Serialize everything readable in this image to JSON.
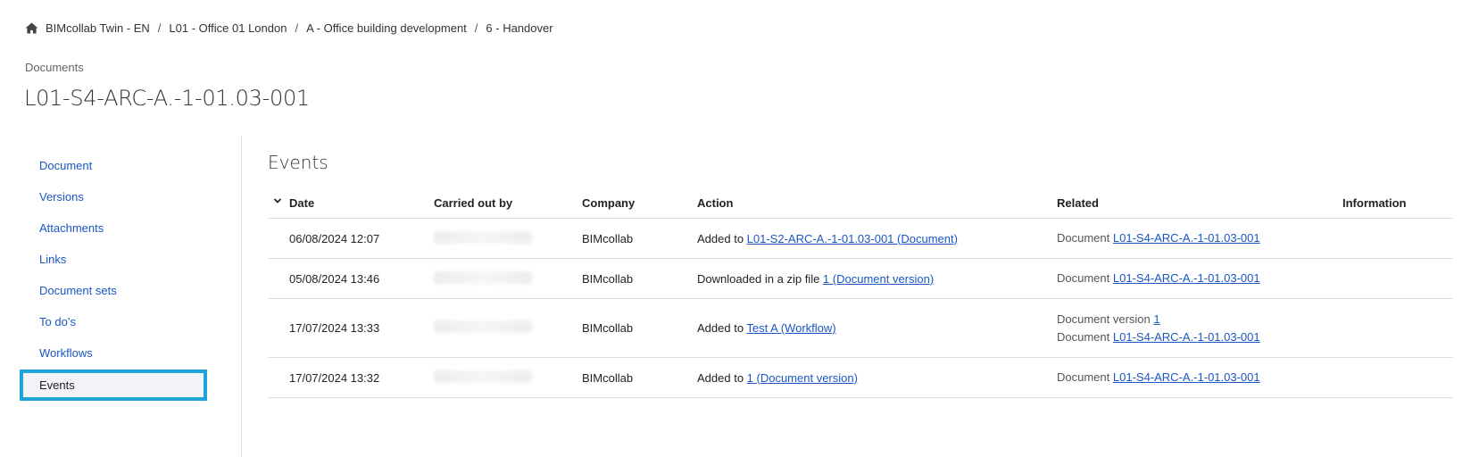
{
  "breadcrumb": {
    "items": [
      "BIMcollab Twin - EN",
      "L01 - Office 01 London",
      "A - Office building development",
      "6 - Handover"
    ],
    "separator": "/"
  },
  "section_label": "Documents",
  "page_title": "L01-S4-ARC-A.-1-01.03-001",
  "sidebar": {
    "items": [
      {
        "label": "Document"
      },
      {
        "label": "Versions"
      },
      {
        "label": "Attachments"
      },
      {
        "label": "Links"
      },
      {
        "label": "Document sets"
      },
      {
        "label": "To do’s"
      },
      {
        "label": "Workflows"
      },
      {
        "label": "Events"
      }
    ],
    "active": "Events"
  },
  "events": {
    "heading": "Events",
    "columns": {
      "date": "Date",
      "carried_out_by": "Carried out by",
      "company": "Company",
      "action": "Action",
      "related": "Related",
      "information": "Information"
    },
    "rows": [
      {
        "date": "06/08/2024 12:07",
        "company": "BIMcollab",
        "action_text": "Added to ",
        "action_link": "L01-S2-ARC-A.-1-01.03-001 (Document)",
        "related": [
          {
            "prefix": "Document ",
            "link": "L01-S4-ARC-A.-1-01.03-001"
          }
        ]
      },
      {
        "date": "05/08/2024 13:46",
        "company": "BIMcollab",
        "action_text": "Downloaded in a zip file ",
        "action_link": "1 (Document version)",
        "related": [
          {
            "prefix": "Document ",
            "link": "L01-S4-ARC-A.-1-01.03-001"
          }
        ]
      },
      {
        "date": "17/07/2024 13:33",
        "company": "BIMcollab",
        "action_text": "Added to ",
        "action_link": "Test A (Workflow)",
        "related": [
          {
            "prefix": "Document version ",
            "link": "1"
          },
          {
            "prefix": "Document ",
            "link": "L01-S4-ARC-A.-1-01.03-001"
          }
        ]
      },
      {
        "date": "17/07/2024 13:32",
        "company": "BIMcollab",
        "action_text": "Added to ",
        "action_link": "1 (Document version)",
        "related": [
          {
            "prefix": "Document ",
            "link": "L01-S4-ARC-A.-1-01.03-001"
          }
        ]
      }
    ]
  },
  "colors": {
    "link": "#1a56c4",
    "active_border": "#1ea4d8",
    "active_bg": "#f1f3f6"
  }
}
